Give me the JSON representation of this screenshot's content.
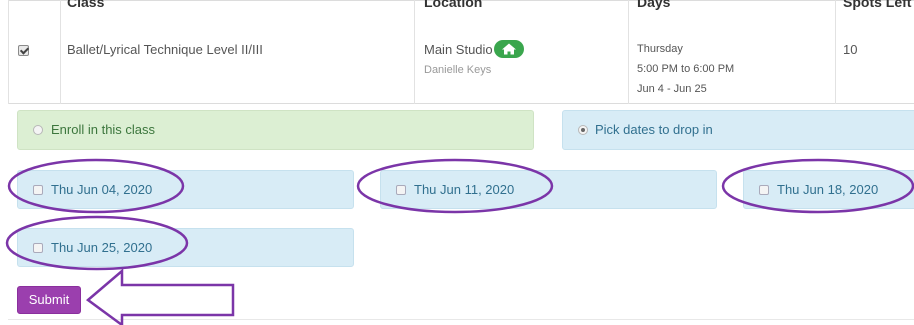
{
  "table": {
    "headers": [
      "Class",
      "Location",
      "Days",
      "Spots Left"
    ],
    "row": {
      "selected": true,
      "class_name": "Ballet/Lyrical Technique Level II/III",
      "location": "Main Studio",
      "location_icon": "home-icon",
      "instructor": "Danielle Keys",
      "day": "Thursday",
      "time": "5:00 PM to 6:00 PM",
      "date_range": "Jun 4 - Jun 25",
      "spots_left": "10"
    }
  },
  "enroll_options": {
    "enroll_label": "Enroll in this class",
    "drop_in_label": "Pick dates to drop in",
    "selected": "drop_in"
  },
  "dates": [
    {
      "label": "Thu Jun 04, 2020",
      "checked": false
    },
    {
      "label": "Thu Jun 11, 2020",
      "checked": false
    },
    {
      "label": "Thu Jun 18, 2020",
      "checked": false
    },
    {
      "label": "Thu Jun 25, 2020",
      "checked": false
    }
  ],
  "submit_label": "Submit",
  "colors": {
    "annotation": "#7b35a8",
    "submit": "#9b3fae",
    "green_panel": "#dcefd3",
    "blue_panel": "#d8ecf6",
    "home_button": "#3aa64d"
  }
}
